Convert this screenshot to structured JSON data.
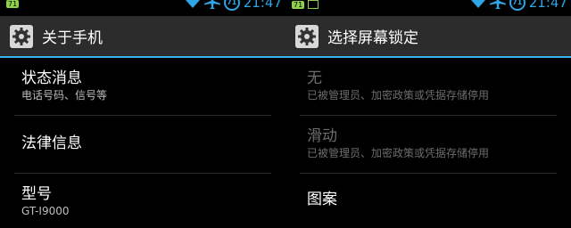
{
  "left": {
    "status": {
      "badge": "71",
      "battery": "71",
      "time": "21:47"
    },
    "title": "关于手机",
    "items": [
      {
        "title": "状态消息",
        "subtitle": "电话号码、信号等"
      },
      {
        "title": "法律信息"
      },
      {
        "title": "型号",
        "subtitle": "GT-I9000"
      }
    ]
  },
  "right": {
    "status": {
      "badge": "71",
      "battery": "71",
      "time": "21:47"
    },
    "title": "选择屏幕锁定",
    "items": [
      {
        "title": "无",
        "subtitle": "已被管理员、加密政策或凭据存储停用"
      },
      {
        "title": "滑动",
        "subtitle": "已被管理员、加密政策或凭据存储停用"
      },
      {
        "title": "图案"
      }
    ]
  },
  "colors": {
    "accent": "#31b6e7",
    "titlebar": "#2c2c2c",
    "status_icons": "#2fa4e7",
    "notification": "#8fd14a"
  }
}
